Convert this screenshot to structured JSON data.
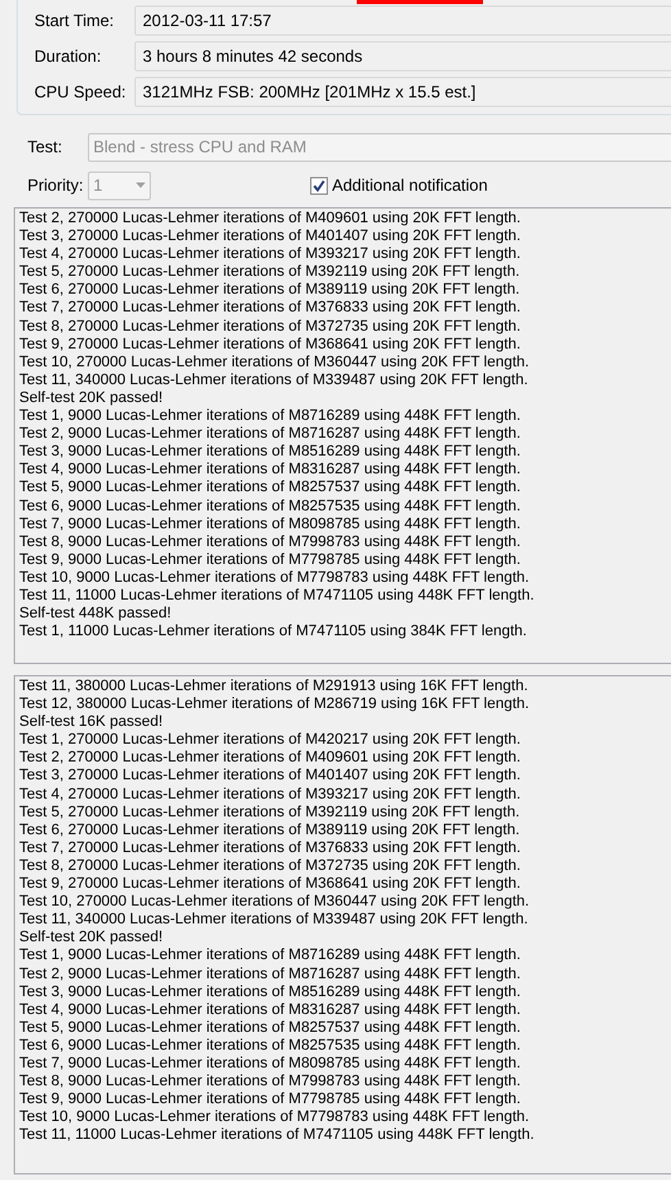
{
  "info": [
    {
      "label": "Start Time:",
      "value": "2012-03-11 17:57"
    },
    {
      "label": "Duration:",
      "value": "3 hours 8 minutes 42 seconds"
    },
    {
      "label": "CPU Speed:",
      "value": "3121MHz FSB: 200MHz [201MHz x 15.5 est.]"
    }
  ],
  "test": {
    "label": "Test:",
    "value": "Blend - stress CPU and RAM",
    "disabled": true
  },
  "priority": {
    "label": "Priority:",
    "value": "1",
    "disabled": true
  },
  "notification": {
    "label": "Additional notification",
    "checked": true
  },
  "logs": [
    {
      "lines": [
        "Test 2, 270000 Lucas-Lehmer iterations of M409601 using 20K FFT length.",
        "Test 3, 270000 Lucas-Lehmer iterations of M401407 using 20K FFT length.",
        "Test 4, 270000 Lucas-Lehmer iterations of M393217 using 20K FFT length.",
        "Test 5, 270000 Lucas-Lehmer iterations of M392119 using 20K FFT length.",
        "Test 6, 270000 Lucas-Lehmer iterations of M389119 using 20K FFT length.",
        "Test 7, 270000 Lucas-Lehmer iterations of M376833 using 20K FFT length.",
        "Test 8, 270000 Lucas-Lehmer iterations of M372735 using 20K FFT length.",
        "Test 9, 270000 Lucas-Lehmer iterations of M368641 using 20K FFT length.",
        "Test 10, 270000 Lucas-Lehmer iterations of M360447 using 20K FFT length.",
        "Test 11, 340000 Lucas-Lehmer iterations of M339487 using 20K FFT length.",
        "Self-test 20K passed!",
        "Test 1, 9000 Lucas-Lehmer iterations of M8716289 using 448K FFT length.",
        "Test 2, 9000 Lucas-Lehmer iterations of M8716287 using 448K FFT length.",
        "Test 3, 9000 Lucas-Lehmer iterations of M8516289 using 448K FFT length.",
        "Test 4, 9000 Lucas-Lehmer iterations of M8316287 using 448K FFT length.",
        "Test 5, 9000 Lucas-Lehmer iterations of M8257537 using 448K FFT length.",
        "Test 6, 9000 Lucas-Lehmer iterations of M8257535 using 448K FFT length.",
        "Test 7, 9000 Lucas-Lehmer iterations of M8098785 using 448K FFT length.",
        "Test 8, 9000 Lucas-Lehmer iterations of M7998783 using 448K FFT length.",
        "Test 9, 9000 Lucas-Lehmer iterations of M7798785 using 448K FFT length.",
        "Test 10, 9000 Lucas-Lehmer iterations of M7798783 using 448K FFT length.",
        "Test 11, 11000 Lucas-Lehmer iterations of M7471105 using 448K FFT length.",
        "Self-test 448K passed!",
        "Test 1, 11000 Lucas-Lehmer iterations of M7471105 using 384K FFT length."
      ]
    },
    {
      "lines": [
        "Test 11, 380000 Lucas-Lehmer iterations of M291913 using 16K FFT length.",
        "Test 12, 380000 Lucas-Lehmer iterations of M286719 using 16K FFT length.",
        "Self-test 16K passed!",
        "Test 1, 270000 Lucas-Lehmer iterations of M420217 using 20K FFT length.",
        "Test 2, 270000 Lucas-Lehmer iterations of M409601 using 20K FFT length.",
        "Test 3, 270000 Lucas-Lehmer iterations of M401407 using 20K FFT length.",
        "Test 4, 270000 Lucas-Lehmer iterations of M393217 using 20K FFT length.",
        "Test 5, 270000 Lucas-Lehmer iterations of M392119 using 20K FFT length.",
        "Test 6, 270000 Lucas-Lehmer iterations of M389119 using 20K FFT length.",
        "Test 7, 270000 Lucas-Lehmer iterations of M376833 using 20K FFT length.",
        "Test 8, 270000 Lucas-Lehmer iterations of M372735 using 20K FFT length.",
        "Test 9, 270000 Lucas-Lehmer iterations of M368641 using 20K FFT length.",
        "Test 10, 270000 Lucas-Lehmer iterations of M360447 using 20K FFT length.",
        "Test 11, 340000 Lucas-Lehmer iterations of M339487 using 20K FFT length.",
        "Self-test 20K passed!",
        "Test 1, 9000 Lucas-Lehmer iterations of M8716289 using 448K FFT length.",
        "Test 2, 9000 Lucas-Lehmer iterations of M8716287 using 448K FFT length.",
        "Test 3, 9000 Lucas-Lehmer iterations of M8516289 using 448K FFT length.",
        "Test 4, 9000 Lucas-Lehmer iterations of M8316287 using 448K FFT length.",
        "Test 5, 9000 Lucas-Lehmer iterations of M8257537 using 448K FFT length.",
        "Test 6, 9000 Lucas-Lehmer iterations of M8257535 using 448K FFT length.",
        "Test 7, 9000 Lucas-Lehmer iterations of M8098785 using 448K FFT length.",
        "Test 8, 9000 Lucas-Lehmer iterations of M7998783 using 448K FFT length.",
        "Test 9, 9000 Lucas-Lehmer iterations of M7798785 using 448K FFT length.",
        "Test 10, 9000 Lucas-Lehmer iterations of M7798783 using 448K FFT length.",
        "Test 11, 11000 Lucas-Lehmer iterations of M7471105 using 448K FFT length."
      ]
    }
  ]
}
